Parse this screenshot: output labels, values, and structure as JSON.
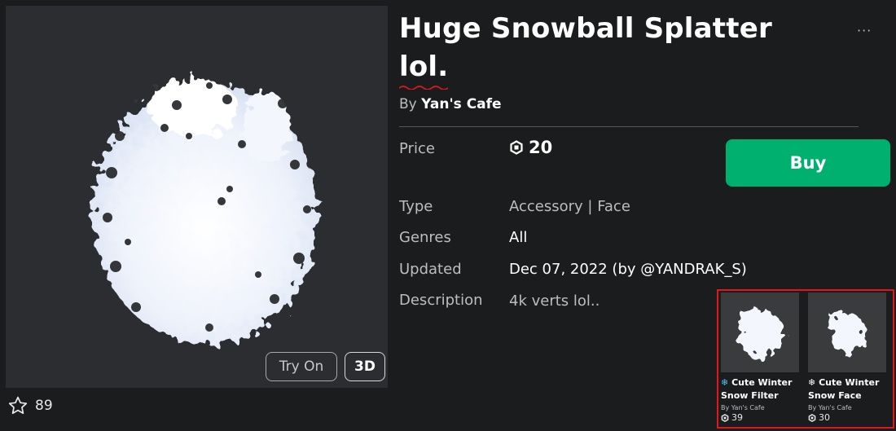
{
  "item": {
    "title_line1": "Huge Snowball Splatter",
    "title_line2": "lol.",
    "by_prefix": "By",
    "creator": "Yan's Cafe",
    "more_label": "···"
  },
  "details": {
    "price_label": "Price",
    "price_value": "20",
    "type_label": "Type",
    "type_value": "Accessory | Face",
    "genres_label": "Genres",
    "genres_value": "All",
    "updated_label": "Updated",
    "updated_value": "Dec 07, 2022 (by @YANDRAK_S)",
    "description_label": "Description",
    "description_value": "4k verts lol.."
  },
  "actions": {
    "buy_label": "Buy",
    "try_on_label": "Try On",
    "three_d_label": "3D"
  },
  "favorites": {
    "count": "89"
  },
  "recommendations": [
    {
      "prefix": "❄",
      "name": "Cute Winter Snow Filter",
      "by": "By Yan's Cafe",
      "price": "39"
    },
    {
      "prefix": "❄",
      "name": "Cute Winter Snow Face",
      "by": "By Yan's Cafe",
      "price": "30"
    }
  ],
  "colors": {
    "background": "#1b1c1e",
    "preview_bg": "#2c2d30",
    "buy_green": "#00b06f",
    "highlight_red": "#e1171e"
  }
}
